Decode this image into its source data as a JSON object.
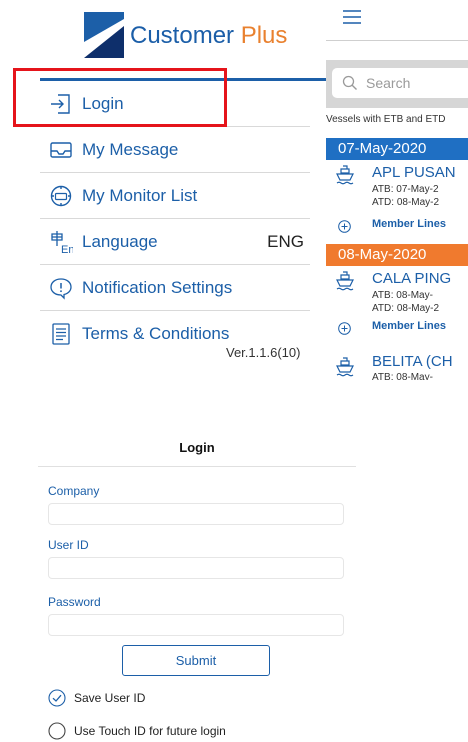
{
  "drawer": {
    "brand": {
      "name": "Customer",
      "accent": "Plus"
    },
    "items": [
      {
        "label": "Login",
        "icon": "login-icon"
      },
      {
        "label": "My Message",
        "icon": "message-icon"
      },
      {
        "label": "My Monitor List",
        "icon": "monitor-icon"
      },
      {
        "label": "Language",
        "icon": "language-icon",
        "value": "ENG"
      },
      {
        "label": "Notification Settings",
        "icon": "notification-icon"
      },
      {
        "label": "Terms & Conditions",
        "icon": "document-icon"
      }
    ],
    "version": "Ver.1.1.6(10)"
  },
  "vessel_panel": {
    "search_placeholder": "Search",
    "subtitle": "Vessels with ETB and ETD",
    "groups": [
      {
        "date": "07-May-2020",
        "vessels": [
          {
            "name": "APL PUSAN",
            "atb": "ATB: 07-May-2",
            "atd": "ATD: 08-May-2",
            "member_lines": "Member Lines"
          }
        ]
      },
      {
        "date": "08-May-2020",
        "vessels": [
          {
            "name": "CALA PING",
            "atb": "ATB: 08-May-",
            "atd": "ATD: 08-May-2",
            "member_lines": "Member Lines"
          },
          {
            "name": "BELITA (CH",
            "atb": "ATB: 08-May-"
          }
        ]
      }
    ]
  },
  "login_form": {
    "title": "Login",
    "fields": {
      "company": {
        "label": "Company",
        "value": "",
        "placeholder": ""
      },
      "user_id": {
        "label": "User ID",
        "value": "",
        "placeholder": ""
      },
      "password": {
        "label": "Password",
        "value": "",
        "placeholder": ""
      }
    },
    "submit_label": "Submit",
    "options": {
      "save_user_id": {
        "label": "Save User ID",
        "checked": true
      },
      "touch_id": {
        "label": "Use Touch ID for future login",
        "checked": false
      }
    }
  },
  "colors": {
    "primary_blue": "#1c5fa8",
    "brand_orange": "#e9812f",
    "date_blue": "#1f6fc3",
    "date_orange": "#f07a2e",
    "highlight_red": "#e5141b"
  }
}
